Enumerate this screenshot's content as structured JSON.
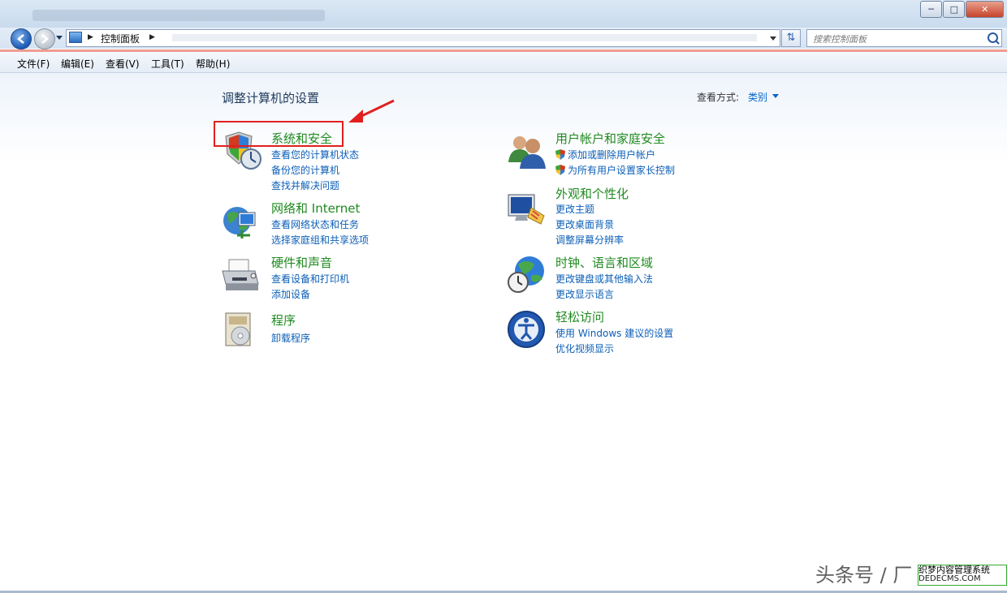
{
  "window": {
    "min_icon": "minimize-icon",
    "max_icon": "maximize-icon",
    "close_icon": "close-icon"
  },
  "address": {
    "breadcrumb": "控制面板",
    "search_placeholder": "搜索控制面板"
  },
  "menu": [
    "文件(F)",
    "编辑(E)",
    "查看(V)",
    "工具(T)",
    "帮助(H)"
  ],
  "page": {
    "title": "调整计算机的设置",
    "view_by_label": "查看方式:",
    "view_by_value": "类别"
  },
  "categories": {
    "system": {
      "title": "系统和安全",
      "links": [
        "查看您的计算机状态",
        "备份您的计算机",
        "查找并解决问题"
      ]
    },
    "network": {
      "title": "网络和 Internet",
      "links": [
        "查看网络状态和任务",
        "选择家庭组和共享选项"
      ]
    },
    "hardware": {
      "title": "硬件和声音",
      "links": [
        "查看设备和打印机",
        "添加设备"
      ]
    },
    "programs": {
      "title": "程序",
      "links": [
        "卸载程序"
      ]
    },
    "users": {
      "title": "用户帐户和家庭安全",
      "links": [
        "添加或删除用户帐户",
        "为所有用户设置家长控制"
      ]
    },
    "appearance": {
      "title": "外观和个性化",
      "links": [
        "更改主题",
        "更改桌面背景",
        "调整屏幕分辨率"
      ]
    },
    "clock": {
      "title": "时钟、语言和区域",
      "links": [
        "更改键盘或其他输入法",
        "更改显示语言"
      ]
    },
    "ease": {
      "title": "轻松访问",
      "links": [
        "使用 Windows 建议的设置",
        "优化视频显示"
      ]
    }
  },
  "watermark": {
    "text": "头条号 / 厂",
    "logo_line1": "织梦内容管理系统",
    "logo_line2": "DEDECMS.COM"
  },
  "colors": {
    "category_title": "#1f8a1f",
    "link": "#0c5fb7",
    "highlight_box": "#e02020"
  }
}
